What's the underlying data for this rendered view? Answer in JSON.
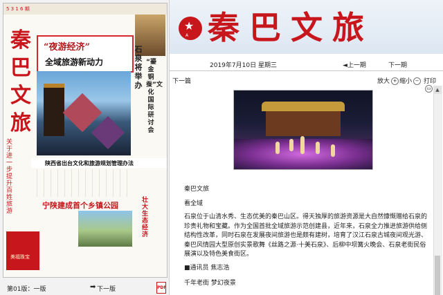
{
  "left_preview": {
    "paper_top_strip": "5 3 1 6 期",
    "masthead_vertical": "秦巴文旅",
    "headline_red": "“夜游经济”",
    "headline_black": "全域旅游新动力",
    "vertical_headline_1": "石泉将举办",
    "vertical_headline_2": "“鎏金铜蚕”文化国际研讨会",
    "left_vertical_red": "关于进一步提升百姓旅游",
    "bar_caption": "陕西省出台文化和旅游规划管理办法",
    "sub_headline": "宁陕建成首个乡镇公园",
    "right_vertical_red": "壮大生态经济",
    "ad_text": "美福珠宝"
  },
  "left_footer": {
    "page_label": "第01版：一版",
    "next_page": "下一版",
    "arrow_icon": "right-arrow-icon",
    "pdf_icon": "pdf-icon"
  },
  "header": {
    "logo_icon": "star-logo-icon",
    "logo_small": "A",
    "title": "秦巴文旅"
  },
  "date_bar": {
    "date": "2019年7月10日 星期三",
    "prev_issue": "◄上一期",
    "next_issue": "下一期"
  },
  "toolbar": {
    "next_article": "下一篇",
    "zoom_in": "放大",
    "zoom_out": "缩小",
    "print": "打印"
  },
  "article": {
    "section": "秦巴文旅",
    "subtitle": "看全域",
    "body": "石泉位于山清水秀、生态优美的秦巴山区。得天独厚的旅游资源是大自然慷慨赠给石泉的珍贵礼物和宝藏。作为全国首批全域旅游示范创建县，近年来，石泉全力推进旅游供给侧结构性改革，同时石泉在发展夜间旅游也是颇有建树，培育了汉江石泉古城夜间观光游、秦巴风情园大型原创实景歌舞《丝路之源·十美石泉》、后柳中坝篝火晚会、石泉老街民俗展演以及特色美食街区。",
    "reporter": "■通讯员 焦志浩",
    "caption": "千年老街 梦幻夜景"
  }
}
